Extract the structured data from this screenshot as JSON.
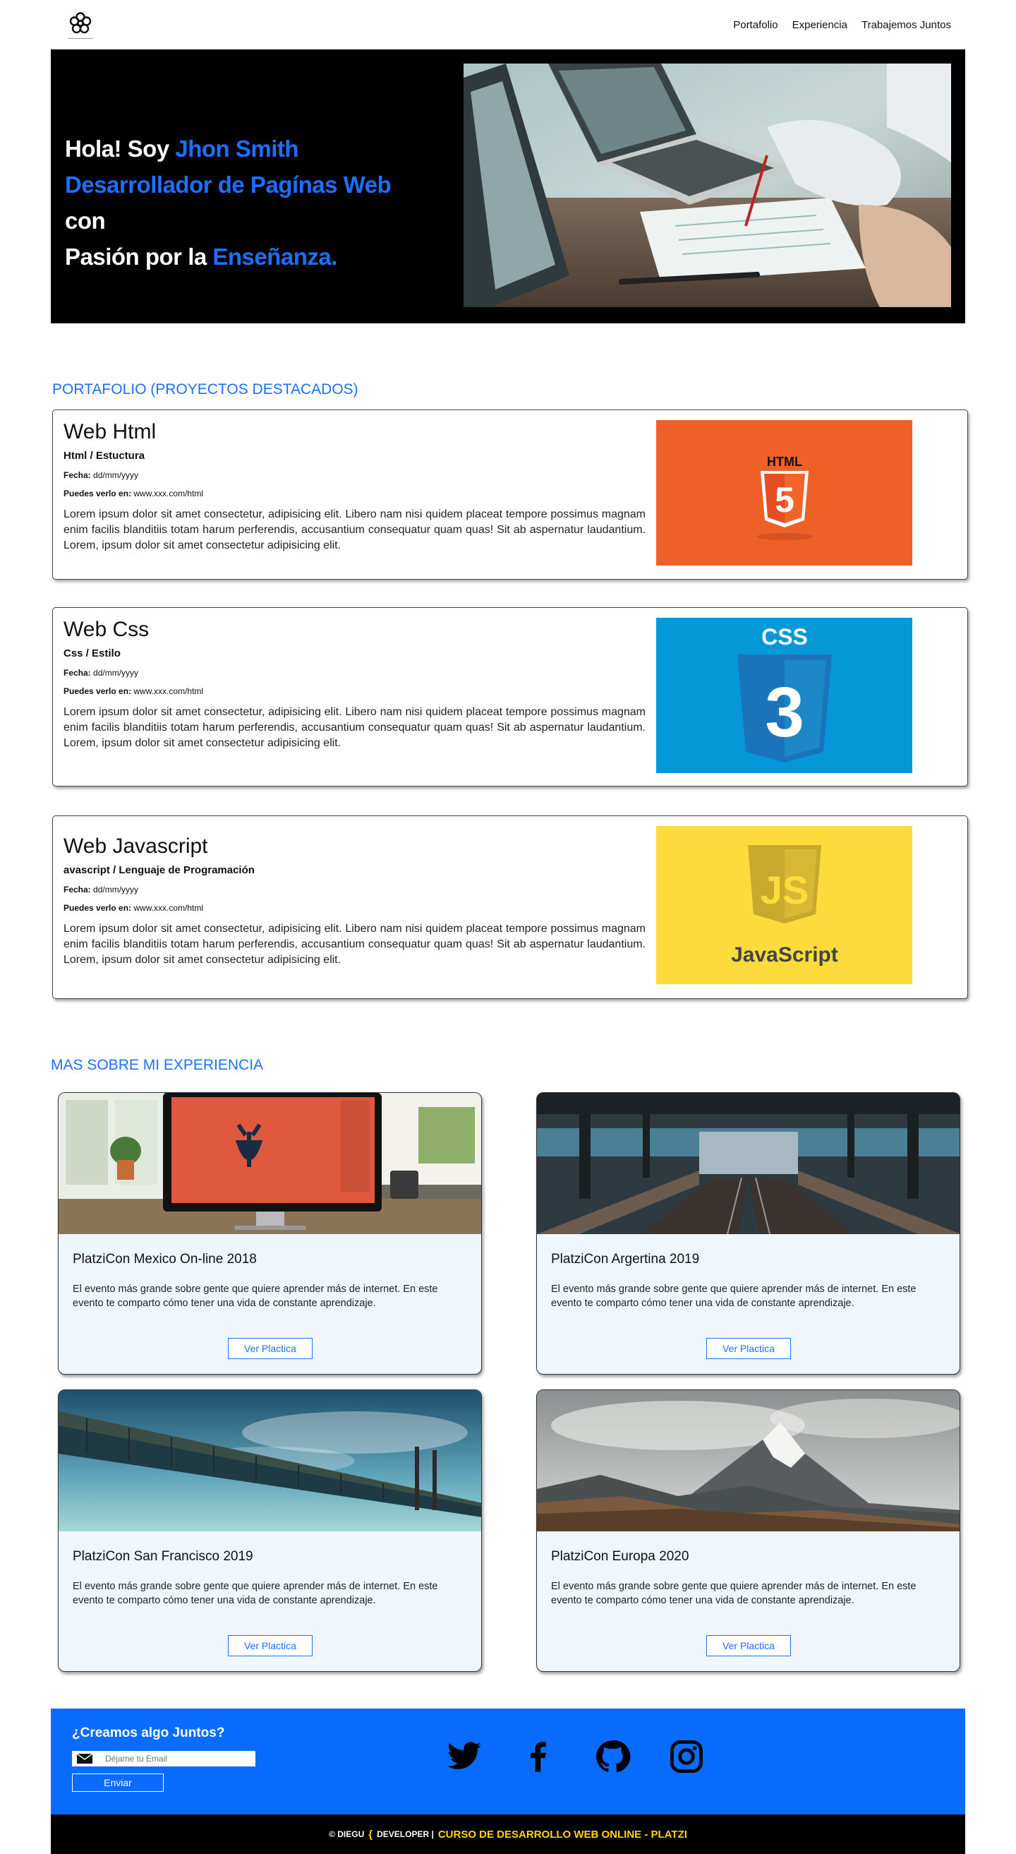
{
  "nav": {
    "logo_icon": "flower-logo-icon",
    "links": [
      "Portafolio",
      "Experiencia",
      "Trabajemos Juntos"
    ]
  },
  "hero": {
    "greeting": "Hola! Soy ",
    "name": "Jhon Smith",
    "role": "Desarrollador de Pagínas Web",
    "connector": " con",
    "passion": "Pasión por la ",
    "focus": "Enseñanza."
  },
  "portfolio": {
    "title": "PORTAFOLIO (PROYECTOS DESTACADOS)",
    "projects": [
      {
        "title": "Web Html",
        "subtitle": "Html / Estuctura",
        "date_label": "Fecha:",
        "date": "dd/mm/yyyy",
        "link_label": "Puedes verlo en:",
        "link": "www.xxx.com/html",
        "description": "Lorem ipsum dolor sit amet consectetur, adipisicing elit. Libero nam nisi quidem placeat tempore possimus magnam enim facilis blanditiis totam harum perferendis, accusantium consequatur quam quas! Sit ab aspernatur laudantium. Lorem, ipsum dolor sit amet consectetur adipisicing elit.",
        "image_badge": "HTML",
        "image_number": "5"
      },
      {
        "title": "Web Css",
        "subtitle": "Css / Estilo",
        "date_label": "Fecha:",
        "date": "dd/mm/yyyy",
        "link_label": "Puedes verlo en:",
        "link": "www.xxx.com/html",
        "description": "Lorem ipsum dolor sit amet consectetur, adipisicing elit. Libero nam nisi quidem placeat tempore possimus magnam enim facilis blanditiis totam harum perferendis, accusantium consequatur quam quas! Sit ab aspernatur laudantium. Lorem, ipsum dolor sit amet consectetur adipisicing elit.",
        "image_badge": "CSS",
        "image_number": "3"
      },
      {
        "title": "Web Javascript",
        "subtitle": "avascript / Lenguaje de Programación",
        "date_label": "Fecha:",
        "date": "dd/mm/yyyy",
        "link_label": "Puedes verlo en:",
        "link": "www.xxx.com/html",
        "description": "Lorem ipsum dolor sit amet consectetur, adipisicing elit. Libero nam nisi quidem placeat tempore possimus magnam enim facilis blanditiis totam harum perferendis, accusantium consequatur quam quas! Sit ab aspernatur laudantium. Lorem, ipsum dolor sit amet consectetur adipisicing elit.",
        "image_badge": "JS",
        "image_caption": "JavaScript"
      }
    ]
  },
  "experience": {
    "title": "MAS SOBRE MI EXPERIENCIA",
    "cards": [
      {
        "title": "PlatziCon Mexico On-line 2018",
        "description": "El evento más grande sobre gente que quiere aprender más de internet. En este evento te comparto cómo tener una vida de constante aprendizaje.",
        "button": "Ver Plactica"
      },
      {
        "title": "PlatziCon Argertina 2019",
        "description": "El evento más grande sobre gente que quiere aprender más de internet. En este evento te comparto cómo tener una vida de constante aprendizaje.",
        "button": "Ver Plactica"
      },
      {
        "title": "PlatziCon San Francisco 2019",
        "description": "El evento más grande sobre gente que quiere aprender más de internet. En este evento te comparto cómo tener una vida de constante aprendizaje.",
        "button": "Ver Plactica"
      },
      {
        "title": "PlatziCon Europa 2020",
        "description": "El evento más grande sobre gente que quiere aprender más de internet. En este evento te comparto cómo tener una vida de constante aprendizaje.",
        "button": "Ver Plactica"
      }
    ]
  },
  "footer": {
    "title": "¿Creamos algo Juntos?",
    "email_placeholder": "Déjame tu Email",
    "submit": "Enviar",
    "social_icons": [
      "twitter-icon",
      "facebook-icon",
      "github-icon",
      "instagram-icon"
    ],
    "copyright_prefix": "© DIEGU",
    "copyright_brace": "{",
    "copyright_suffix": "DEVELOPER |",
    "course": "CURSO DE DESARROLLO WEB ONLINE - PLATZI"
  },
  "colors": {
    "accent": "#1f6fff",
    "footer_blue": "#0a6cff",
    "footer_yellow": "#ffd400",
    "html_orange": "#ef5f28",
    "css_blue": "#0598d8",
    "js_yellow": "#fedb3c"
  }
}
